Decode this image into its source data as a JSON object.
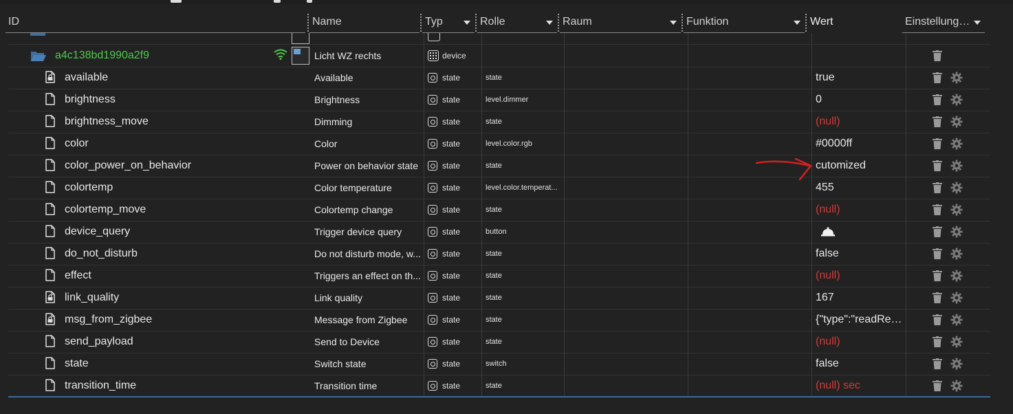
{
  "header": {
    "id": "ID",
    "name": "Name",
    "typ": "Typ",
    "rolle": "Rolle",
    "raum": "Raum",
    "funktion": "Funktion",
    "wert": "Wert",
    "einstellungen": "Einstellung…"
  },
  "device": {
    "id": "a4c138bd1990a2f9",
    "name": "Licht WZ rechts",
    "type": "device"
  },
  "rows": [
    {
      "id": "available",
      "name": "Available",
      "type": "state",
      "role": "state",
      "value": "true",
      "null": false,
      "locked": true
    },
    {
      "id": "brightness",
      "name": "Brightness",
      "type": "state",
      "role": "level.dimmer",
      "value": "0",
      "null": false,
      "locked": false
    },
    {
      "id": "brightness_move",
      "name": "Dimming",
      "type": "state",
      "role": "state",
      "value": "(null)",
      "null": true,
      "locked": false
    },
    {
      "id": "color",
      "name": "Color",
      "type": "state",
      "role": "level.color.rgb",
      "value": "#0000ff",
      "null": false,
      "locked": false
    },
    {
      "id": "color_power_on_behavior",
      "name": "Power on behavior state",
      "type": "state",
      "role": "state",
      "value": "cutomized",
      "null": false,
      "locked": false
    },
    {
      "id": "colortemp",
      "name": "Color temperature",
      "type": "state",
      "role": "level.color.temperat...",
      "value": "455",
      "null": false,
      "locked": false
    },
    {
      "id": "colortemp_move",
      "name": "Colortemp change",
      "type": "state",
      "role": "state",
      "value": "(null)",
      "null": true,
      "locked": false
    },
    {
      "id": "device_query",
      "name": "Trigger device query",
      "type": "state",
      "role": "button",
      "value": "",
      "null": false,
      "locked": false,
      "bell": true
    },
    {
      "id": "do_not_disturb",
      "name": "Do not disturb mode, w...",
      "type": "state",
      "role": "state",
      "value": "false",
      "null": false,
      "locked": false
    },
    {
      "id": "effect",
      "name": "Triggers an effect on th...",
      "type": "state",
      "role": "state",
      "value": "(null)",
      "null": true,
      "locked": false
    },
    {
      "id": "link_quality",
      "name": "Link quality",
      "type": "state",
      "role": "state",
      "value": "167",
      "null": false,
      "locked": true
    },
    {
      "id": "msg_from_zigbee",
      "name": "Message from Zigbee",
      "type": "state",
      "role": "state",
      "value": "{\"type\":\"readRes...",
      "null": false,
      "locked": true
    },
    {
      "id": "send_payload",
      "name": "Send to Device",
      "type": "state",
      "role": "state",
      "value": "(null)",
      "null": true,
      "locked": false
    },
    {
      "id": "state",
      "name": "Switch state",
      "type": "state",
      "role": "switch",
      "value": "false",
      "null": false,
      "locked": false
    },
    {
      "id": "transition_time",
      "name": "Transition time",
      "type": "state",
      "role": "state",
      "value": "(null) sec",
      "null": true,
      "locked": false
    }
  ],
  "icons": {
    "folder": "folder-open-icon",
    "wifi": "wifi-icon",
    "file": "file-icon",
    "locked_file": "locked-file-icon",
    "trash": "trash-icon",
    "gear": "gear-icon",
    "bell": "bell-icon",
    "annotation": "red-arrow-annotation"
  },
  "colors": {
    "background": "#222222",
    "device_id": "#4ec94e",
    "null_value": "#d43a3a",
    "folder": "#4a7fb5",
    "bottom_line": "#3d6b9a",
    "annotation_arrow": "#d42020"
  }
}
